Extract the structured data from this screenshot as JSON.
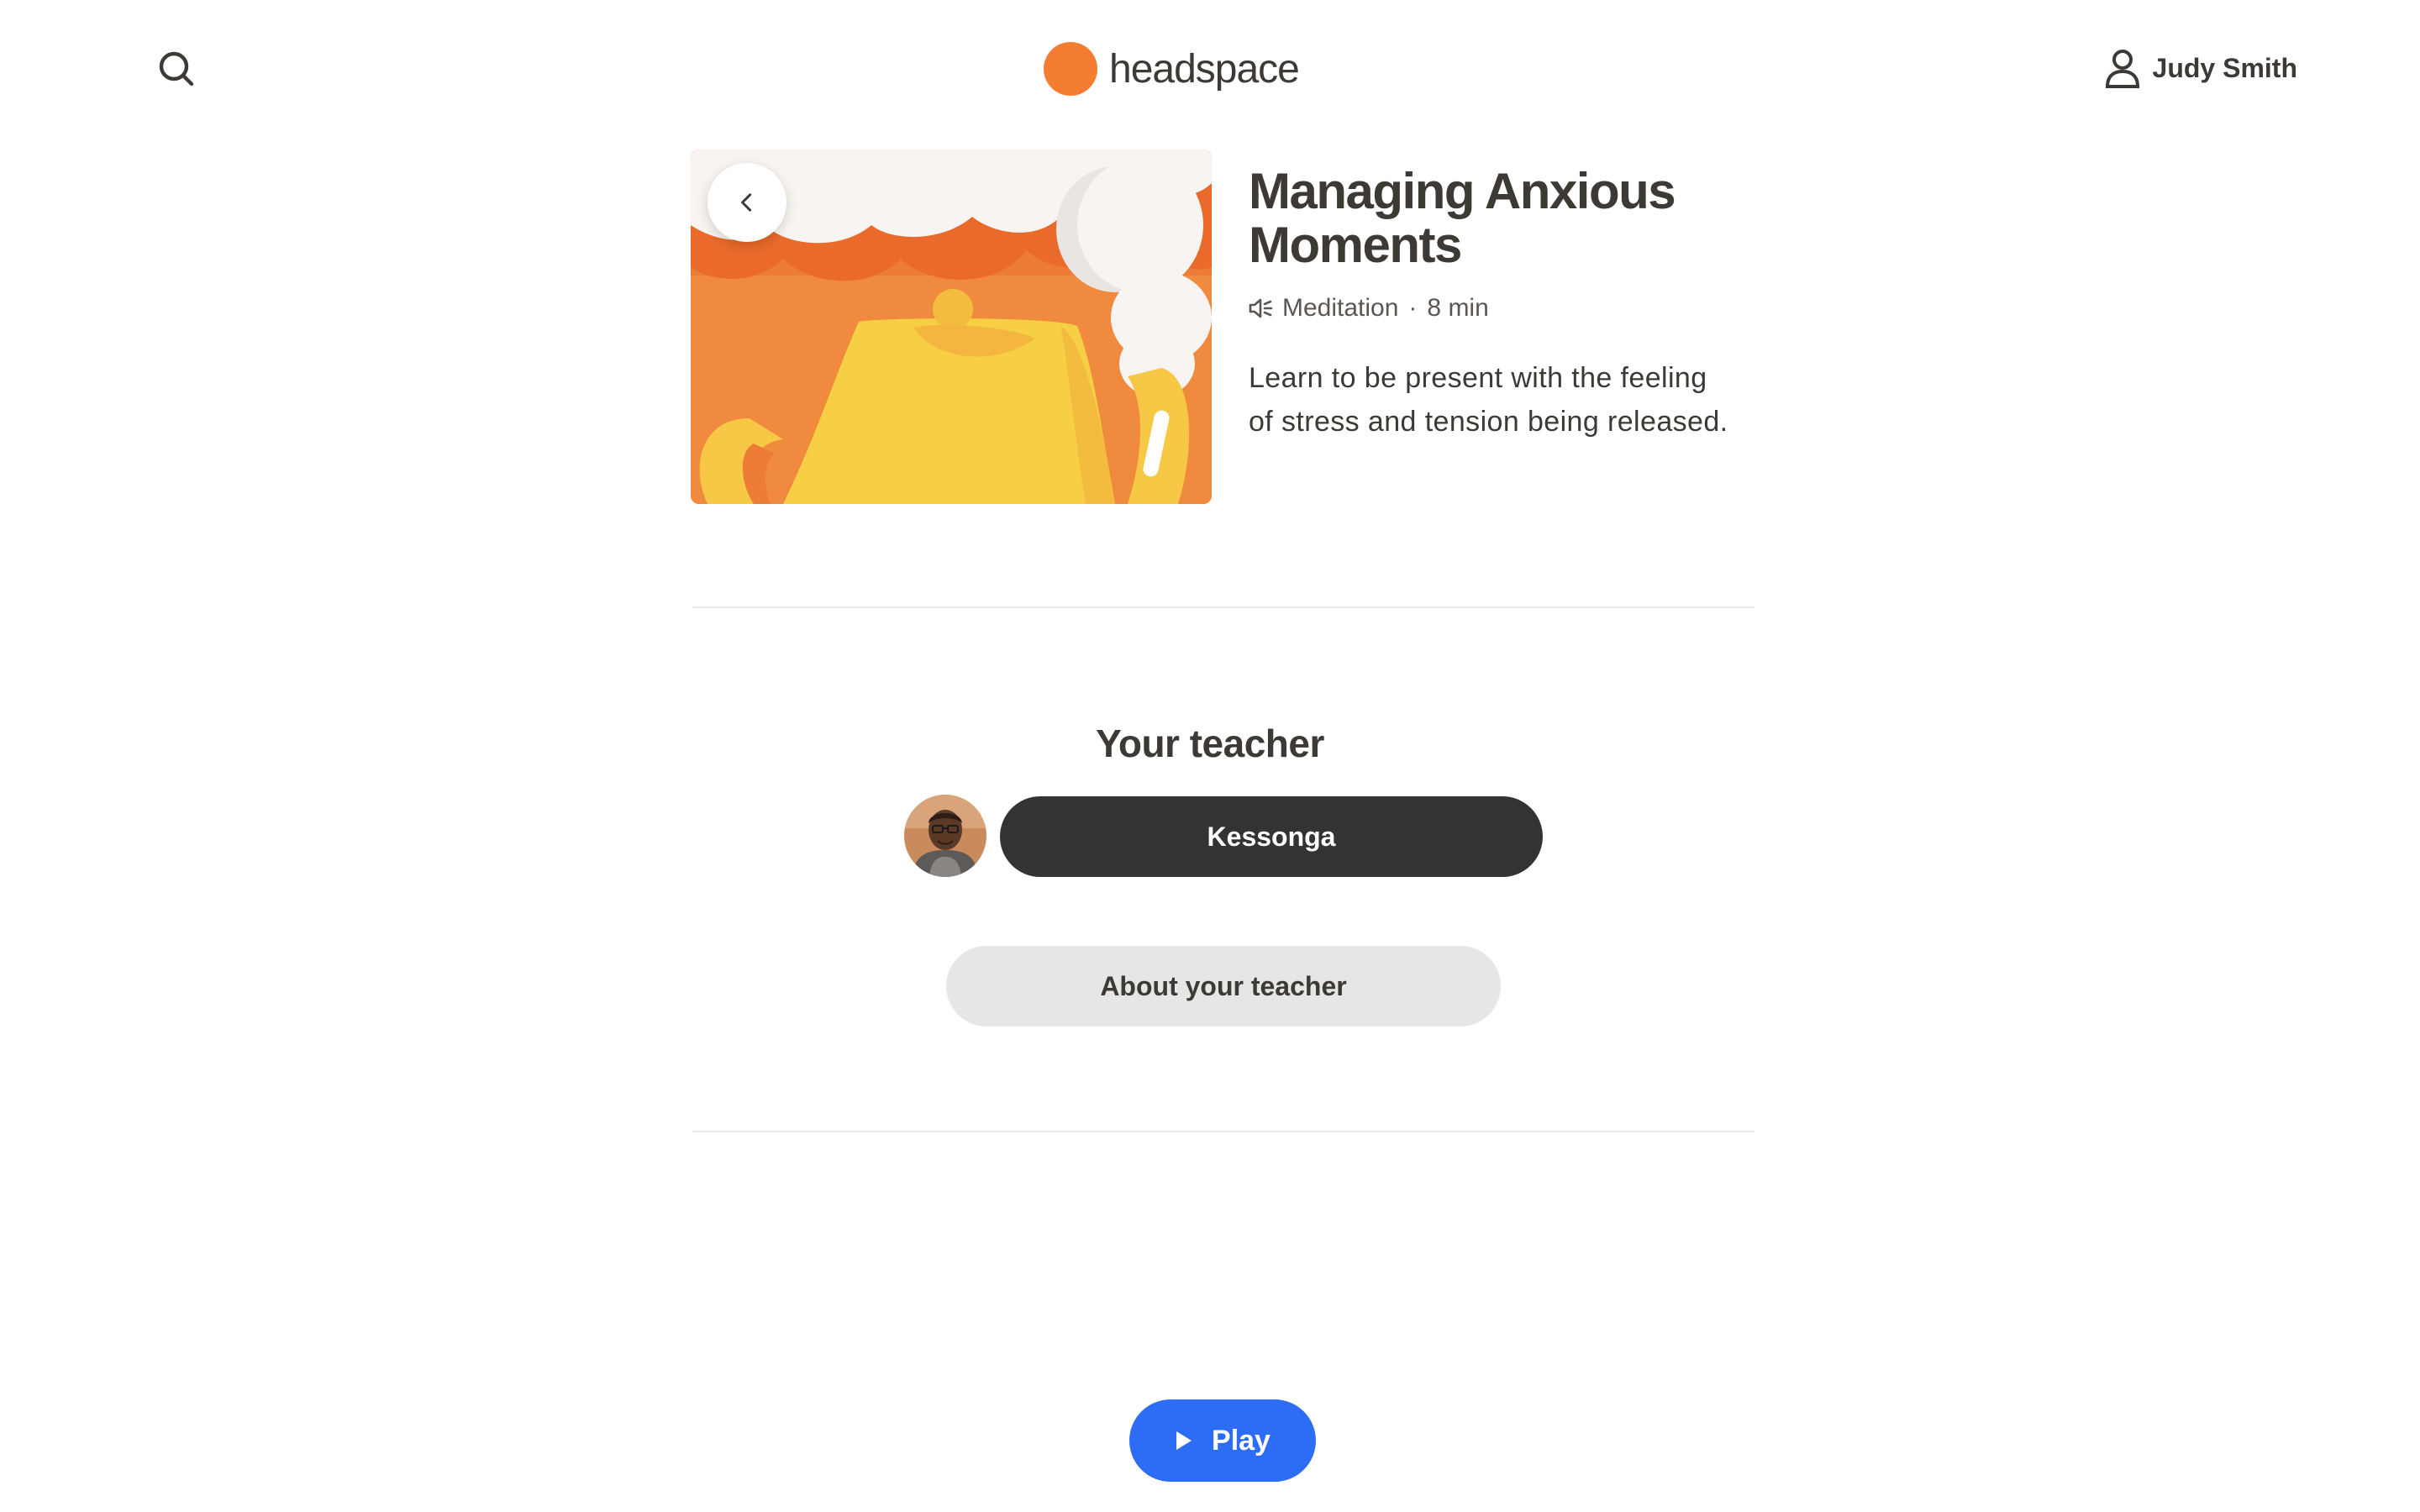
{
  "header": {
    "search_icon": "search-icon",
    "logo_text": "headspace",
    "user_name": "Judy Smith",
    "user_icon": "user-icon"
  },
  "session": {
    "title": "Managing Anxious Moments",
    "type": "Meditation",
    "separator": "·",
    "duration": "8 min",
    "meta_icon": "speaker-icon",
    "description": "Learn to be present with the feeling of stress and tension being released."
  },
  "teacher": {
    "heading": "Your teacher",
    "name": "Kessonga",
    "about_label": "About your teacher"
  },
  "player": {
    "play_label": "Play",
    "play_icon": "play-icon"
  },
  "colors": {
    "brand_orange": "#f47d31",
    "text_dark": "#3d3935",
    "teacher_button": "#333333",
    "about_button": "#e6e6e6",
    "play_button": "#2d6cf5"
  }
}
